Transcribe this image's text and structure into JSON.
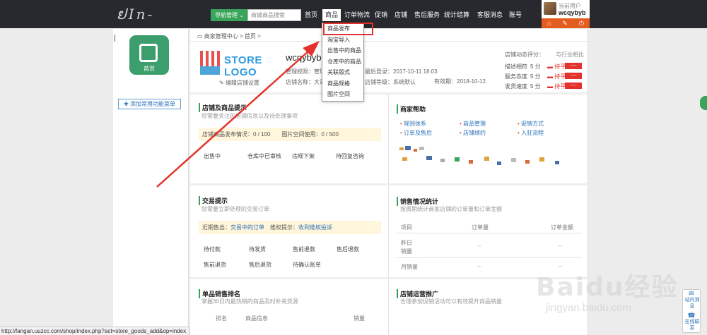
{
  "topbar": {
    "logo": "ຢIn-",
    "nav_manage": "导航管理 ⌄",
    "search_placeholder": "商城商品搜索",
    "menus": [
      "首页",
      "商品",
      "订单物流",
      "促销",
      "店铺",
      "售后服务",
      "统计结算",
      "客服消息",
      "账号"
    ],
    "user_label": "当前用户",
    "user_name": "wcqybyb"
  },
  "dropdown": [
    "商品发布",
    "淘宝导入",
    "出售中的商品",
    "仓库中的商品",
    "关联版式",
    "商品规格",
    "图片空间"
  ],
  "left": {
    "home_label": "首页",
    "add_menu": "添加常用功能菜单"
  },
  "breadcrumb": "商家管理中心 > 首页 >",
  "store": {
    "logo_text": "STORE LOGO",
    "edit": "编辑店铺设置",
    "name": "wcqybyb",
    "perm": "管理权限：管理",
    "last_login": "最后登录：2017-10-11 18:03",
    "store_name": "店铺名称：大哥",
    "grade": "店铺等级：系统默认",
    "expire": "有效期：2018-10-12"
  },
  "ratings": {
    "title": "店铺动态评分：",
    "compare": "与行业相比",
    "rows": [
      {
        "label": "描述相符",
        "score": "5 分",
        "trend": "持平",
        "box": "----"
      },
      {
        "label": "服务态度",
        "score": "5 分",
        "trend": "持平",
        "box": "----"
      },
      {
        "label": "发货速度",
        "score": "5 分",
        "trend": "持平",
        "box": "----"
      }
    ]
  },
  "store_tips": {
    "title": "店铺及商品提示",
    "sub": "您需要关注的店铺信息以及待处理事项",
    "bar": "店铺商品发布情况：0 / 100　　图片空间使用：0 / 500",
    "items": [
      "出售中",
      "仓库中已审核",
      "违规下架",
      "待回复咨询"
    ]
  },
  "help": {
    "title": "商家帮助",
    "links": [
      "规则体系",
      "商品管理",
      "促销方式",
      "订单及售后",
      "店铺续约",
      "入驻流程"
    ]
  },
  "trade": {
    "title": "交易提示",
    "sub": "您需要立即处理的交易订单",
    "bar_prefix1": "近期售出：",
    "bar_link1": "交易中的订单",
    "bar_prefix2": "维权提示：",
    "bar_link2": "收到维权投诉",
    "items": [
      "待付款",
      "待发货",
      "售前退款",
      "售后退款",
      "售前退货",
      "售后退货",
      "待确认账单"
    ]
  },
  "sales": {
    "title": "销售情况统计",
    "sub": "按周期统计商家店铺的订单量和订单金额",
    "headers": [
      "项目",
      "订单量",
      "订单金额"
    ],
    "rows": [
      {
        "label": "昨日销量",
        "count": "--",
        "amount": "--"
      },
      {
        "label": "月销量",
        "count": "--",
        "amount": "--"
      }
    ]
  },
  "rank": {
    "title": "单品销售排名",
    "sub": "掌握30日内最热销的商品及时补充货源",
    "headers": [
      "排名",
      "商品信息",
      "销量"
    ]
  },
  "promo": {
    "title": "店铺运营推广",
    "sub": "合理参加促销活动可以有效提升商品销量"
  },
  "statusbar": "http://fangan.uuzcc.com/shop/index.php?act=store_goods_add&op=index",
  "sidewidget": [
    "站内消息",
    "在线联系"
  ],
  "watermark": "Baidu经验",
  "watermark_url": "jingyan.baidu.com",
  "colors": {
    "topbar": "#27292e",
    "green": "#3aa45a",
    "red": "#e2322b",
    "link": "#2a70b8"
  }
}
